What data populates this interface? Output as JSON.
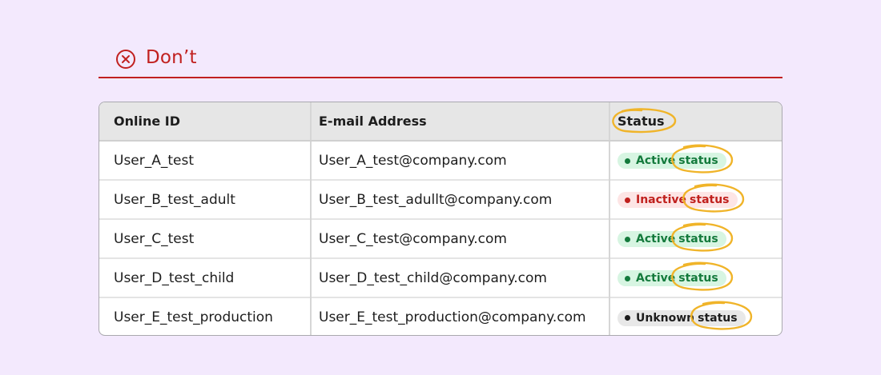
{
  "header": {
    "title": "Don’t",
    "icon": "circle-x-icon",
    "color": "#c1201f"
  },
  "table": {
    "columns": [
      "Online ID",
      "E-mail Address",
      "Status"
    ],
    "rows": [
      {
        "id": "User_A_test",
        "email": "User_A_test@company.com",
        "status": "Active",
        "status_word": "status",
        "kind": "active"
      },
      {
        "id": "User_B_test_adult",
        "email": "User_B_test_adullt@company.com",
        "status": "Inactive",
        "status_word": "status",
        "kind": "inactive"
      },
      {
        "id": "User_C_test",
        "email": "User_C_test@company.com",
        "status": "Active",
        "status_word": "status",
        "kind": "active"
      },
      {
        "id": "User_D_test_child",
        "email": "User_D_test_child@company.com",
        "status": "Active",
        "status_word": "status",
        "kind": "active"
      },
      {
        "id": "User_E_test_production",
        "email": "User_E_test_production@company.com",
        "status": "Unknown",
        "status_word": "status",
        "kind": "unknown"
      }
    ]
  },
  "status_colors": {
    "active": {
      "bg": "#d7f5e2",
      "fg": "#147a3c"
    },
    "inactive": {
      "bg": "#fde5e5",
      "fg": "#c0201d"
    },
    "unknown": {
      "bg": "#e8e8e8",
      "fg": "#1d1d1d"
    }
  },
  "annotation_color": "#f0b429"
}
